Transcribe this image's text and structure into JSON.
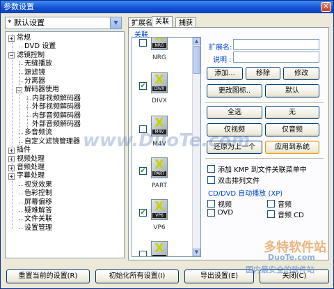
{
  "window": {
    "title": "参数设置",
    "close_glyph": "✕"
  },
  "preset": {
    "value": "* 默认设置"
  },
  "tree": {
    "expand_glyph": "+",
    "collapse_glyph": "−",
    "items": [
      {
        "label": "常规",
        "state": "collapsed"
      },
      {
        "label": "DVD 设置",
        "state": "leaf"
      },
      {
        "label": "滤镜控制",
        "state": "expanded"
      },
      {
        "label": "无缝播放",
        "state": "leaf"
      },
      {
        "label": "源滤镜",
        "state": "leaf"
      },
      {
        "label": "分离器",
        "state": "leaf"
      },
      {
        "label": "解码器使用",
        "state": "expanded"
      },
      {
        "label": "内部视频解码器",
        "state": "leaf"
      },
      {
        "label": "外部视频解码器",
        "state": "leaf"
      },
      {
        "label": "内部音频解码器",
        "state": "leaf"
      },
      {
        "label": "外部音频解码器",
        "state": "leaf"
      },
      {
        "label": "多音频流",
        "state": "leaf"
      },
      {
        "label": "自定义滤镜管理器",
        "state": "leaf"
      },
      {
        "label": "插件",
        "state": "collapsed"
      },
      {
        "label": "视频处理",
        "state": "collapsed"
      },
      {
        "label": "音频处理",
        "state": "collapsed"
      },
      {
        "label": "字幕处理",
        "state": "collapsed"
      },
      {
        "label": "视觉效果",
        "state": "leaf"
      },
      {
        "label": "色彩控制",
        "state": "leaf"
      },
      {
        "label": "屏幕偏移",
        "state": "leaf"
      },
      {
        "label": "疑难解答",
        "state": "leaf"
      },
      {
        "label": "文件关联",
        "state": "leaf"
      },
      {
        "label": "设置管理",
        "state": "leaf"
      }
    ]
  },
  "tabs": [
    {
      "label": "扩展名",
      "active": false
    },
    {
      "label": "关联",
      "active": true
    },
    {
      "label": "捕获",
      "active": false
    }
  ],
  "panel": {
    "section_title": "关联",
    "formats": [
      {
        "name": "NRG",
        "tag": "NRG",
        "checked": false
      },
      {
        "name": "DIVX",
        "tag": "DIVX",
        "checked": true
      },
      {
        "name": "M4V",
        "tag": "M4V",
        "checked": false
      },
      {
        "name": "PART",
        "tag": "PART",
        "checked": true
      },
      {
        "name": "VP6",
        "tag": "VP6",
        "checked": true
      },
      {
        "name": "",
        "tag": "",
        "checked": false
      }
    ],
    "check_glyph": "✔",
    "scroll_up": "▲",
    "scroll_down": "▼",
    "ext_label": "扩展名:",
    "desc_label": "说明 :",
    "ext_value": "",
    "desc_value": "",
    "buttons": {
      "add": "添加...",
      "remove": "移除",
      "modify": "修改",
      "change_icon": "更改图标..",
      "default": "默认",
      "select_all": "全选",
      "none": "无",
      "video_only": "仅视频",
      "audio_only": "仅音频",
      "restore": "还原为上一个",
      "apply_system": "应用到系统"
    },
    "add_kmp_menu": "添加 KMP 到文件关联菜单中",
    "dblclick_playlist": "双击排列文件",
    "autoplay_title": "CD/DVD 自动播放 (XP)",
    "autoplay": {
      "video": "视频",
      "audio": "音频",
      "dvd": "DVD",
      "audio_cd": "音频 CD"
    }
  },
  "bottom": {
    "reset_current": "重置当前的设置(R)",
    "init_all": "初始化所有设置(I)",
    "export": "导出设置(E)",
    "close": "关闭(C)"
  },
  "watermarks": {
    "duote_mid": "www.DuoTe.com",
    "brand": "多特软件站",
    "duote_small": "DuoTe.com",
    "slogan": "国内最安全的软件站"
  }
}
